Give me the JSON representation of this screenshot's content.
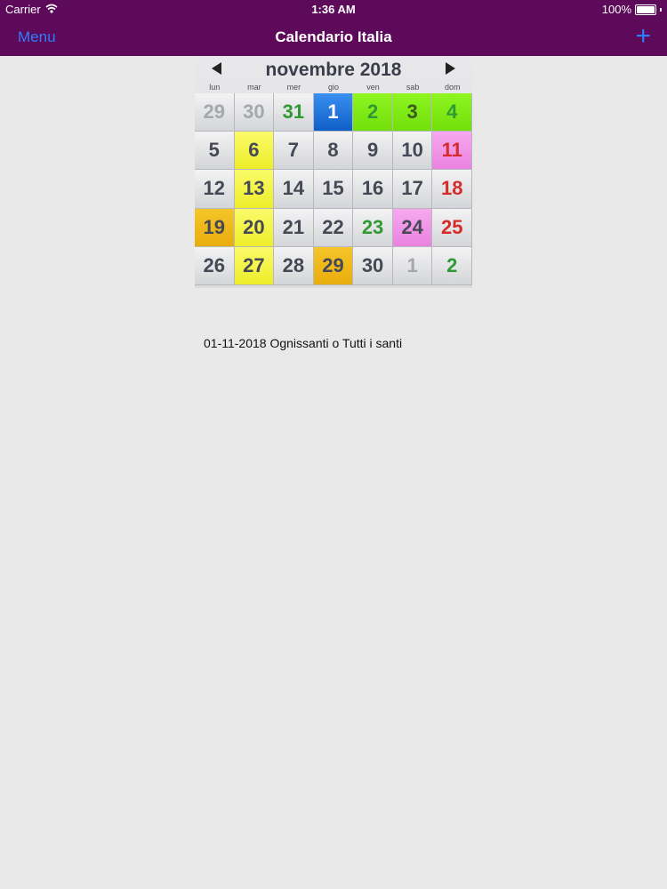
{
  "status_bar": {
    "carrier": "Carrier",
    "time": "1:36 AM",
    "battery": "100%",
    "icons": [
      "wifi-icon",
      "battery-icon"
    ]
  },
  "nav": {
    "menu_label": "Menu",
    "title": "Calendario Italia",
    "add_label": "+"
  },
  "calendar": {
    "month_label": "novembre 2018",
    "weekdays": [
      "lun",
      "mar",
      "mer",
      "gio",
      "ven",
      "sab",
      "dom"
    ],
    "days": [
      {
        "label": "29",
        "style": "other"
      },
      {
        "label": "30",
        "style": "other"
      },
      {
        "label": "31",
        "style": "holiday-text"
      },
      {
        "label": "1",
        "style": "selected"
      },
      {
        "label": "2",
        "style": "bg-green holiday-text"
      },
      {
        "label": "3",
        "style": "bg-green selected-green"
      },
      {
        "label": "4",
        "style": "bg-green holiday-text"
      },
      {
        "label": "5",
        "style": ""
      },
      {
        "label": "6",
        "style": "bg-yellow"
      },
      {
        "label": "7",
        "style": ""
      },
      {
        "label": "8",
        "style": ""
      },
      {
        "label": "9",
        "style": ""
      },
      {
        "label": "10",
        "style": ""
      },
      {
        "label": "11",
        "style": "bg-pink sunday"
      },
      {
        "label": "12",
        "style": ""
      },
      {
        "label": "13",
        "style": "bg-yellow"
      },
      {
        "label": "14",
        "style": ""
      },
      {
        "label": "15",
        "style": ""
      },
      {
        "label": "16",
        "style": ""
      },
      {
        "label": "17",
        "style": ""
      },
      {
        "label": "18",
        "style": "sunday"
      },
      {
        "label": "19",
        "style": "bg-orange"
      },
      {
        "label": "20",
        "style": "bg-yellow"
      },
      {
        "label": "21",
        "style": ""
      },
      {
        "label": "22",
        "style": ""
      },
      {
        "label": "23",
        "style": "holiday-text"
      },
      {
        "label": "24",
        "style": "bg-pink"
      },
      {
        "label": "25",
        "style": "sunday"
      },
      {
        "label": "26",
        "style": ""
      },
      {
        "label": "27",
        "style": "bg-yellow"
      },
      {
        "label": "28",
        "style": ""
      },
      {
        "label": "29",
        "style": "bg-orange"
      },
      {
        "label": "30",
        "style": ""
      },
      {
        "label": "1",
        "style": "other"
      },
      {
        "label": "2",
        "style": "holiday-text"
      }
    ]
  },
  "event": {
    "text": "01-11-2018 Ognissanti o Tutti i santi"
  },
  "colors": {
    "nav_background": "#5e0a5b",
    "accent_blue": "#2f7dfb",
    "page_background": "#e9e9ea"
  }
}
